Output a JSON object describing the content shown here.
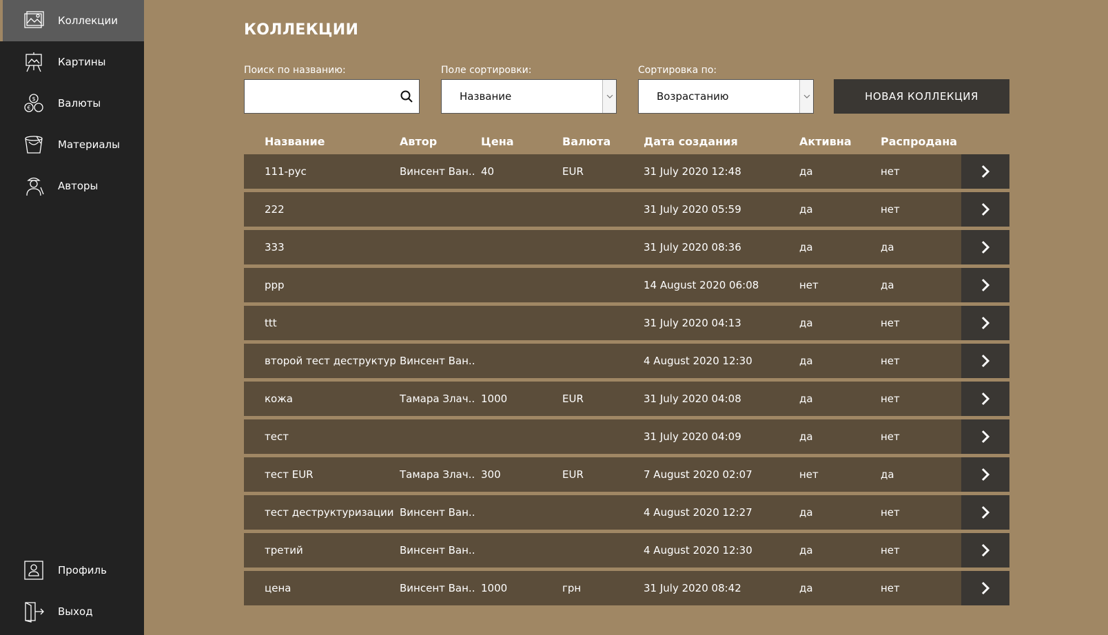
{
  "sidebar": {
    "items": [
      {
        "label": "Коллекции",
        "icon": "image-frame-icon",
        "active": true
      },
      {
        "label": "Картины",
        "icon": "easel-icon",
        "active": false
      },
      {
        "label": "Валюты",
        "icon": "coins-icon",
        "active": false
      },
      {
        "label": "Материалы",
        "icon": "paint-bucket-icon",
        "active": false
      },
      {
        "label": "Авторы",
        "icon": "artist-icon",
        "active": false
      }
    ],
    "bottom": [
      {
        "label": "Профиль",
        "icon": "user-icon"
      },
      {
        "label": "Выход",
        "icon": "exit-icon"
      }
    ]
  },
  "main": {
    "title": "КОЛЛЕКЦИИ",
    "search": {
      "label": "Поиск по названию:",
      "value": ""
    },
    "sort_field": {
      "label": "Поле сортировки:",
      "value": "Название"
    },
    "sort_order": {
      "label": "Сортировка по:",
      "value": "Возрастанию"
    },
    "new_button": "НОВАЯ КОЛЛЕКЦИЯ",
    "table": {
      "columns": [
        "Название",
        "Автор",
        "Цена",
        "Валюта",
        "Дата создания",
        "Активна",
        "Распродана"
      ],
      "rows": [
        [
          "111-рус",
          "Винсент Ван...",
          "40",
          "EUR",
          "31 July 2020 12:48",
          "да",
          "нет"
        ],
        [
          "222",
          "",
          "",
          "",
          "31 July 2020 05:59",
          "да",
          "нет"
        ],
        [
          "333",
          "",
          "",
          "",
          "31 July 2020 08:36",
          "да",
          "да"
        ],
        [
          "ppp",
          "",
          "",
          "",
          "14 August 2020 06:08",
          "нет",
          "да"
        ],
        [
          "ttt",
          "",
          "",
          "",
          "31 July 2020 04:13",
          "да",
          "нет"
        ],
        [
          "второй тест деструктур...",
          "Винсент Ван...",
          "",
          "",
          "4 August 2020 12:30",
          "да",
          "нет"
        ],
        [
          "кожа",
          "Тамара Злач...",
          "1000",
          "EUR",
          "31 July 2020 04:08",
          "да",
          "нет"
        ],
        [
          "тест",
          "",
          "",
          "",
          "31 July 2020 04:09",
          "да",
          "нет"
        ],
        [
          "тест EUR",
          "Тамара Злач...",
          "300",
          "EUR",
          "7 August 2020 02:07",
          "нет",
          "да"
        ],
        [
          "тест деструктуризации",
          "Винсент Ван...",
          "",
          "",
          "4 August 2020 12:27",
          "да",
          "нет"
        ],
        [
          "третий",
          "Винсент Ван...",
          "",
          "",
          "4 August 2020 12:30",
          "да",
          "нет"
        ],
        [
          "цена",
          "Винсент Ван...",
          "1000",
          "грн",
          "31 July 2020 08:42",
          "да",
          "нет"
        ]
      ]
    }
  },
  "colors": {
    "background": "#a08764",
    "sidebar": "#222222",
    "row": "#5b4d3a",
    "button": "#3a3733"
  }
}
